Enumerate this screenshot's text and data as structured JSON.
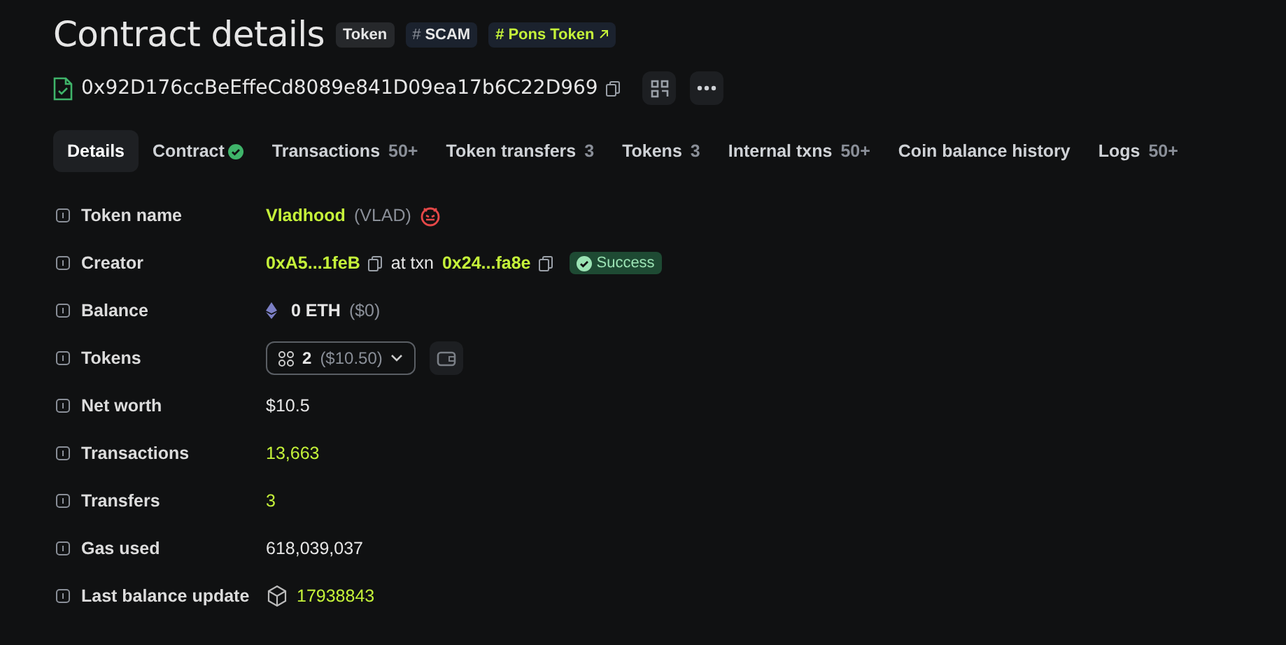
{
  "title": "Contract details",
  "tags": [
    {
      "kind": "plain",
      "label": "Token"
    },
    {
      "kind": "hash",
      "prefix": "#",
      "label": "SCAM"
    },
    {
      "kind": "link",
      "prefix": "#",
      "label": "Pons Token"
    }
  ],
  "address": {
    "value": "0x92D176ccBeEffeCd8089e841D09ea17b6C22D969",
    "verified": true
  },
  "tabs": [
    {
      "label": "Details",
      "selected": true,
      "verified": false
    },
    {
      "label": "Contract",
      "selected": false,
      "verified": true
    },
    {
      "label": "Transactions",
      "count": "50+",
      "selected": false,
      "verified": false
    },
    {
      "label": "Token transfers",
      "count": "3",
      "selected": false,
      "verified": false
    },
    {
      "label": "Tokens",
      "count": "3",
      "selected": false,
      "verified": false
    },
    {
      "label": "Internal txns",
      "count": "50+",
      "selected": false,
      "verified": false
    },
    {
      "label": "Coin balance history",
      "selected": false,
      "verified": false
    },
    {
      "label": "Logs",
      "count": "50+",
      "selected": false,
      "verified": false
    }
  ],
  "rows": [
    {
      "kind": "token",
      "label": "Token name",
      "name": "Vladhood",
      "symbol": "(VLAD)"
    },
    {
      "kind": "creator",
      "label": "Creator",
      "address": "0xA5...1feB",
      "connector": "at txn",
      "txn": "0x24...fa8e",
      "status": "Success"
    },
    {
      "kind": "balance",
      "label": "Balance",
      "amount": "0 ETH",
      "fiat": "($0)"
    },
    {
      "kind": "tokens",
      "label": "Tokens",
      "count": "2",
      "fiat": "($10.50)"
    },
    {
      "kind": "plain",
      "label": "Net worth",
      "value": "$10.5"
    },
    {
      "kind": "link",
      "label": "Transactions",
      "value": "13,663"
    },
    {
      "kind": "link",
      "label": "Transfers",
      "value": "3"
    },
    {
      "kind": "plain",
      "label": "Gas used",
      "value": "618,039,037"
    },
    {
      "kind": "block",
      "label": "Last balance update",
      "value": "17938843"
    }
  ]
}
